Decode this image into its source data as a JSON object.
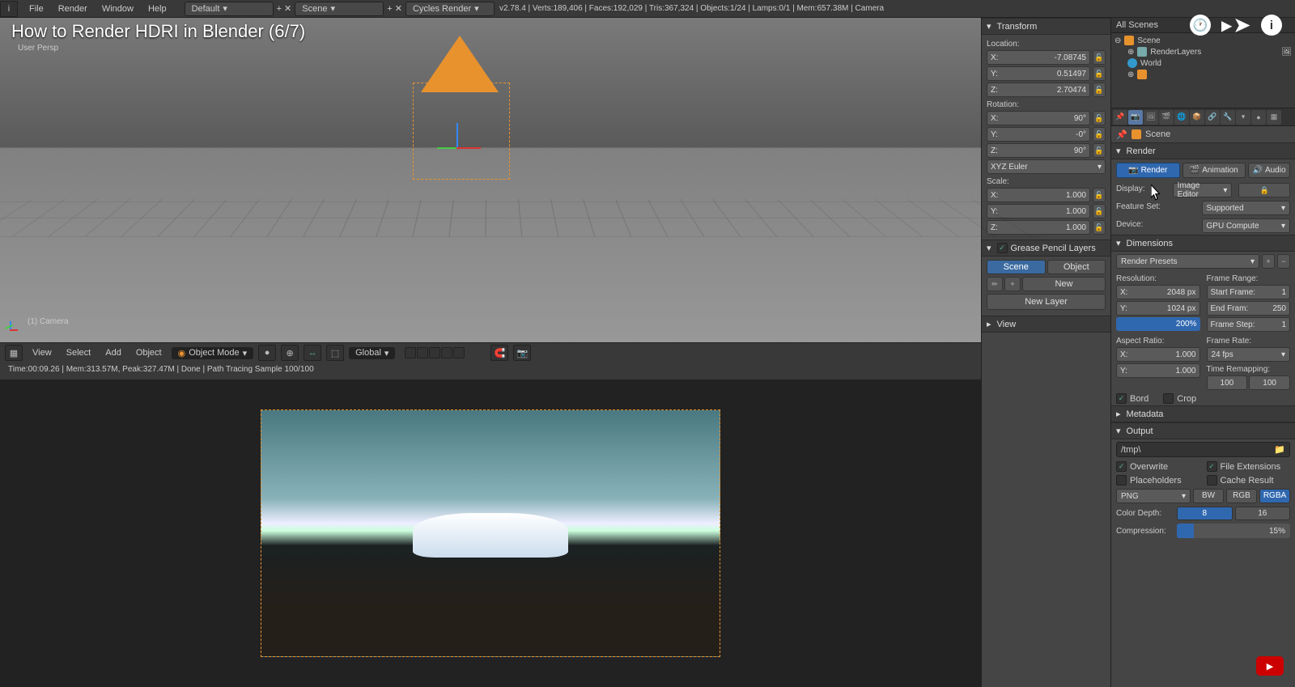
{
  "video_title": "How to Render HDRI in Blender (6/7)",
  "user_persp": "User Persp",
  "camera_label": "(1) Camera",
  "topbar": {
    "menus": [
      "File",
      "Render",
      "Window",
      "Help"
    ],
    "layout": "Default",
    "scene": "Scene",
    "engine": "Cycles Render",
    "stats": "v2.78.4 | Verts:189,406 | Faces:192,029 | Tris:367,324 | Objects:1/24 | Lamps:0/1 | Mem:657.38M | Camera"
  },
  "header3d": {
    "menus": [
      "View",
      "Select",
      "Add",
      "Object"
    ],
    "mode": "Object Mode",
    "orient": "Global"
  },
  "render_status": "Time:00:09.26 | Mem:313.57M, Peak:327.47M | Done | Path Tracing Sample 100/100",
  "npanel": {
    "transform": "Transform",
    "location": "Location:",
    "loc": {
      "x_k": "X:",
      "x_v": "-7.08745",
      "y_k": "Y:",
      "y_v": "0.51497",
      "z_k": "Z:",
      "z_v": "2.70474"
    },
    "rotation": "Rotation:",
    "rot": {
      "x_k": "X:",
      "x_v": "90°",
      "y_k": "Y:",
      "y_v": "-0°",
      "z_k": "Z:",
      "z_v": "90°",
      "mode": "XYZ Euler"
    },
    "scale": "Scale:",
    "scl": {
      "x_k": "X:",
      "x_v": "1.000",
      "y_k": "Y:",
      "y_v": "1.000",
      "z_k": "Z:",
      "z_v": "1.000"
    },
    "gp_head": "Grease Pencil Layers",
    "gp_scene": "Scene",
    "gp_object": "Object",
    "gp_new": "New",
    "gp_newlayer": "New Layer",
    "view_head": "View"
  },
  "outliner": {
    "head": "All Scenes",
    "scene": "Scene",
    "renderlayers": "RenderLayers",
    "world": "World"
  },
  "breadcrumb": "Scene",
  "render_panel": {
    "head": "Render",
    "render": "Render",
    "animation": "Animation",
    "audio": "Audio",
    "display_k": "Display:",
    "display_v": "Image Editor",
    "fset_k": "Feature Set:",
    "fset_v": "Supported",
    "device_k": "Device:",
    "device_v": "GPU Compute"
  },
  "dims": {
    "head": "Dimensions",
    "presets": "Render Presets",
    "resolution": "Resolution:",
    "rx_k": "X:",
    "rx_v": "2048 px",
    "ry_k": "Y:",
    "ry_v": "1024 px",
    "pct": "200%",
    "framerange": "Frame Range:",
    "sf_k": "Start Frame:",
    "sf_v": "1",
    "ef_k": "End Fram:",
    "ef_v": "250",
    "fs_k": "Frame Step:",
    "fs_v": "1",
    "aspect": "Aspect Ratio:",
    "ax_k": "X:",
    "ax_v": "1.000",
    "ay_k": "Y:",
    "ay_v": "1.000",
    "frate": "Frame Rate:",
    "frate_v": "24 fps",
    "timeremap": "Time Remapping:",
    "tr_a": "100",
    "tr_b": "100",
    "border": "Bord",
    "crop": "Crop"
  },
  "metadata": "Metadata",
  "output": {
    "head": "Output",
    "path": "/tmp\\",
    "overwrite": "Overwrite",
    "fileext": "File Extensions",
    "placeholders": "Placeholders",
    "cache": "Cache Result",
    "format": "PNG",
    "bw": "BW",
    "rgb": "RGB",
    "rgba": "RGBA",
    "cdepth": "Color Depth:",
    "d8": "8",
    "d16": "16",
    "comp": "Compression:",
    "comp_v": "15%"
  }
}
